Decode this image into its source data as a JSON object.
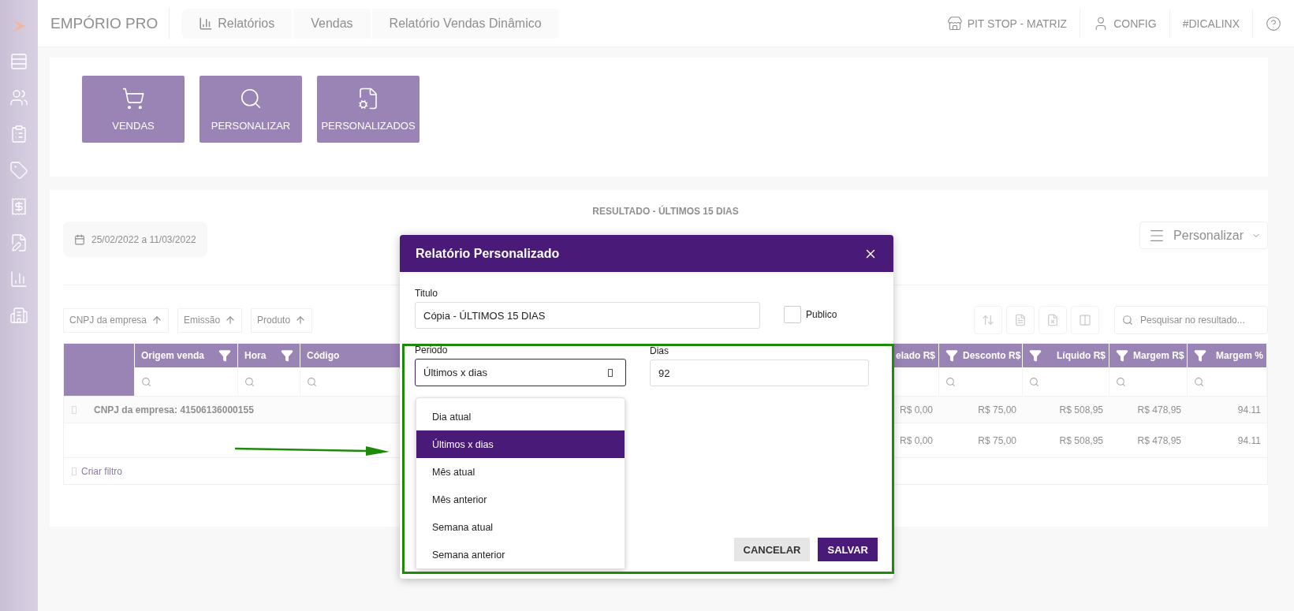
{
  "brand": "EMPÓRIO PRO",
  "breadcrumbs": [
    {
      "label": "Relatórios",
      "kind": "chart"
    },
    {
      "label": "Vendas",
      "kind": "plain"
    },
    {
      "label": "Relatório Vendas Dinâmico",
      "kind": "plain"
    }
  ],
  "top_links": [
    {
      "label": "PIT STOP - MATRIZ",
      "kind": "store"
    },
    {
      "label": "CONFIG",
      "kind": "user"
    },
    {
      "label": "#DICALINX",
      "kind": "plain"
    },
    {
      "kind": "help"
    }
  ],
  "tiles": [
    {
      "label": "VENDAS",
      "kind": "cart"
    },
    {
      "label": "PERSONALIZAR",
      "kind": "search"
    },
    {
      "label": "PERSONALIZADOS",
      "kind": "report"
    }
  ],
  "result": {
    "title": "RESULTADO - ÚLTIMOS 15 DIAS",
    "date_range": "25/02/2022 a 11/03/2022",
    "customize_button": "Personalizar",
    "sort_chips": [
      "CNPJ da empresa",
      "Emissão",
      "Produto"
    ],
    "search_placeholder": "Pesquisar no resultado...",
    "table": {
      "columns": [
        {
          "kind": "text",
          "filter": false
        },
        {
          "label": "Origem venda",
          "kind": "text",
          "filter": true
        },
        {
          "label": "Hora",
          "kind": "text",
          "filter": true
        },
        {
          "label": "Código",
          "kind": "text"
        },
        {
          "label": "elado R$",
          "kind": "amount"
        },
        {
          "label": "Desconto R$",
          "kind": "amount",
          "filter": true
        },
        {
          "label": "Líquido R$",
          "kind": "amount",
          "filter": true
        },
        {
          "label": "Margem R$",
          "kind": "amount",
          "filter": true
        },
        {
          "label": "Margem %",
          "kind": "amount",
          "filter": true
        }
      ],
      "group_row": {
        "label": "CNPJ da empresa: 41506136000155",
        "values": [
          "R$ 0,00",
          "R$ 75,00",
          "R$ 508,95",
          "R$ 478,95",
          "94.11"
        ]
      },
      "rows": [
        {
          "values": [
            "R$ 0,00",
            "R$ 75,00",
            "R$ 508,95",
            "R$ 478,95",
            "94.11"
          ]
        }
      ],
      "footer": "Criar filtro"
    }
  },
  "dialog": {
    "title": "Relatório Personalizado",
    "title_field": {
      "label": "Titulo",
      "value": "Cópia - ÚLTIMOS 15 DIAS"
    },
    "public": {
      "label": "Publico",
      "checked": false
    },
    "period": {
      "label": "Periodo",
      "value": "Últimos x dias",
      "expanded": true,
      "options": [
        {
          "label": "Dia atual",
          "selected": false
        },
        {
          "label": "Últimos x dias",
          "selected": true
        },
        {
          "label": "Mês atual",
          "selected": false
        },
        {
          "label": "Mês anterior",
          "selected": false
        },
        {
          "label": "Semana atual",
          "selected": false
        },
        {
          "label": "Semana anterior",
          "selected": false
        }
      ]
    },
    "days": {
      "label": "Dias",
      "value": "92"
    },
    "buttons": [
      {
        "label": "CANCELAR",
        "kind": "secondary"
      },
      {
        "label": "SALVAR",
        "kind": "primary"
      }
    ]
  }
}
